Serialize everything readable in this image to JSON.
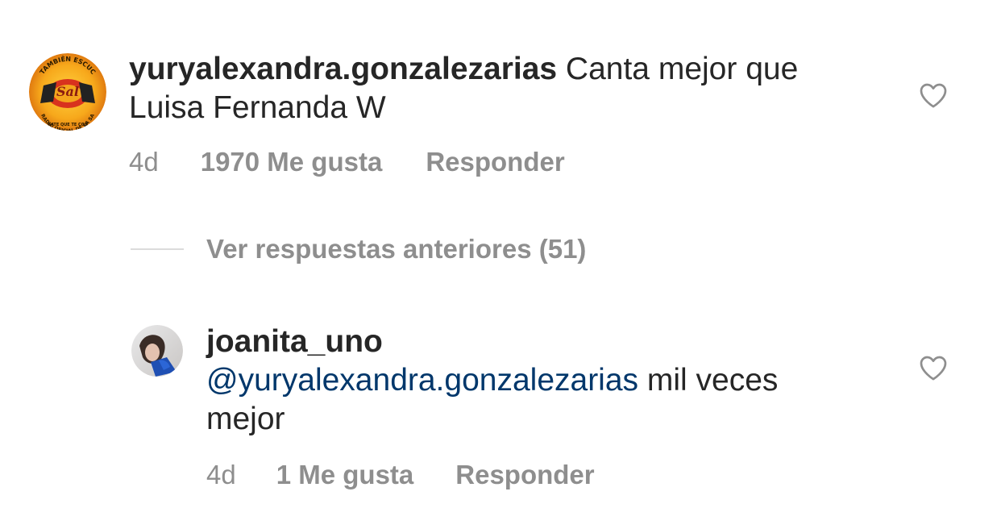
{
  "comment": {
    "username": "yuryalexandra.gonzalezarias",
    "text_line1": " Canta mejor que",
    "text_line2": "Luisa Fernanda W",
    "time": "4d",
    "likes": "1970 Me gusta",
    "reply_label": "Responder",
    "avatar_text_top": "TAMBIÉN ESCUC",
    "avatar_text_bottom": "RADIO OFICIAL DE LA SA",
    "avatar_text_bottom2": "GATE QUE TE CON"
  },
  "view_replies": {
    "label": "Ver respuestas anteriores (51)"
  },
  "reply": {
    "username": "joanita_uno",
    "mention": "@yuryalexandra.gonzalezarias",
    "text_after_mention": " mil veces",
    "text_line3": "mejor",
    "time": "4d",
    "likes": "1 Me gusta",
    "reply_label": "Responder"
  },
  "colors": {
    "text": "#262626",
    "secondary": "#8e8e8e",
    "mention": "#00376b",
    "divider": "#dbdbdb"
  }
}
